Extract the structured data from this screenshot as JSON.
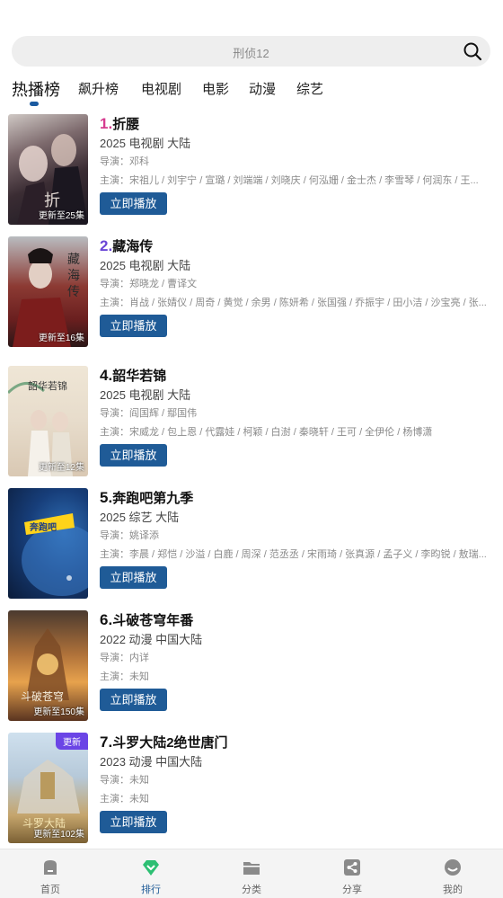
{
  "search": {
    "placeholder": "刑侦12"
  },
  "tabs": [
    {
      "label": "热播榜",
      "active": true
    },
    {
      "label": "飙升榜"
    },
    {
      "label": "电视剧"
    },
    {
      "label": "电影"
    },
    {
      "label": "动漫"
    },
    {
      "label": "综艺"
    }
  ],
  "items": [
    {
      "rank": "1.",
      "rank_color": "#d63b8f",
      "title": "折腰",
      "meta": "2025  电视剧  大陆",
      "director": "导演：邓科",
      "cast": "主演：宋祖儿 / 刘宇宁 / 宣璐 / 刘端端 / 刘晓庆 / 何泓姗 / 金士杰 / 李雪琴 / 何润东 / 王...",
      "update": "更新至25集",
      "play": "立即播放"
    },
    {
      "rank": "2.",
      "rank_color": "#6a46d6",
      "title": "藏海传",
      "meta": "2025  电视剧  大陆",
      "director": "导演：郑晓龙 / 曹译文",
      "cast": "主演：肖战 / 张婧仪 / 周奇 / 黄觉 / 余男 / 陈妍希 / 张国强 / 乔振宇 / 田小洁 / 沙宝亮 / 张...",
      "update": "更新至16集",
      "play": "立即播放"
    },
    {
      "rank": "4.",
      "rank_color": "#111111",
      "title": "韶华若锦",
      "meta": "2025  电视剧  大陆",
      "director": "导演：阎国辉 / 鄢国伟",
      "cast": "主演：宋威龙 / 包上恩 / 代露娃 / 柯颖 / 白澍 / 秦晓轩 / 王可 / 全伊伦 / 杨博潇",
      "update": "更新至12集",
      "play": "立即播放"
    },
    {
      "rank": "5.",
      "rank_color": "#111111",
      "title": "奔跑吧第九季",
      "meta": "2025  综艺  大陆",
      "director": "导演：姚译添",
      "cast": "主演：李晨 / 郑恺 / 沙溢 / 白鹿 / 周深 / 范丞丞 / 宋雨琦 / 张真源 / 孟子义 / 李昀锐 / 敖瑞...",
      "update": "",
      "play": "立即播放"
    },
    {
      "rank": "6.",
      "rank_color": "#111111",
      "title": "斗破苍穹年番",
      "meta": "2022  动漫  中国大陆",
      "director": "导演：内详",
      "cast": "主演：未知",
      "update": "更新至150集",
      "play": "立即播放"
    },
    {
      "rank": "7.",
      "rank_color": "#111111",
      "title": "斗罗大陆2绝世唐门",
      "meta": "2023  动漫  中国大陆",
      "director": "导演：未知",
      "cast": "主演：未知",
      "update": "更新至102集",
      "badge": "更新",
      "play": "立即播放"
    }
  ],
  "bottom_nav": [
    {
      "label": "首页",
      "icon": "home-icon"
    },
    {
      "label": "排行",
      "icon": "rank-icon",
      "active": true
    },
    {
      "label": "分类",
      "icon": "folder-icon"
    },
    {
      "label": "分享",
      "icon": "share-icon"
    },
    {
      "label": "我的",
      "icon": "profile-icon"
    }
  ],
  "colors": {
    "accent": "#1f5b97",
    "search_bg": "#eeeeee",
    "rank_green": "#2dbf73"
  }
}
